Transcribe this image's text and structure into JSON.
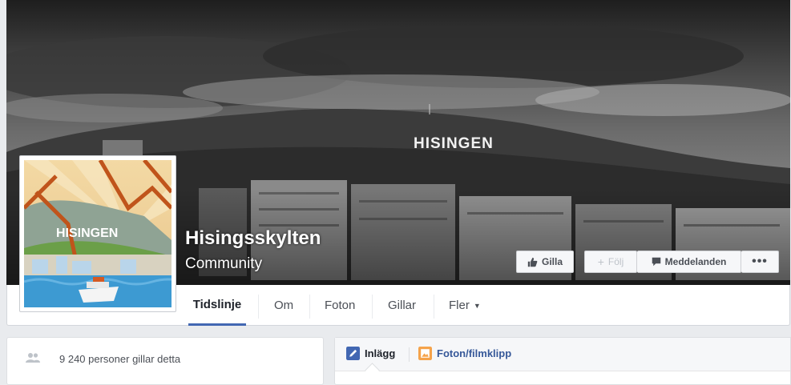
{
  "cover": {
    "sign_text": "HISINGEN"
  },
  "profile": {
    "sign_text": "HISINGEN"
  },
  "page": {
    "name": "Hisingsskylten",
    "category": "Community"
  },
  "actions": {
    "like_label": "Gilla",
    "follow_label": "Följ",
    "message_label": "Meddelanden",
    "more_label": "•••"
  },
  "tabs": [
    {
      "label": "Tidslinje",
      "active": true
    },
    {
      "label": "Om"
    },
    {
      "label": "Foton"
    },
    {
      "label": "Gillar"
    },
    {
      "label": "Fler",
      "has_caret": true
    }
  ],
  "likes": {
    "text": "9 240 personer gillar detta"
  },
  "composer": {
    "post_label": "Inlägg",
    "photo_label": "Foton/filmklipp"
  },
  "colors": {
    "accent": "#4267b2",
    "link": "#365899",
    "background": "#e9ebee"
  }
}
